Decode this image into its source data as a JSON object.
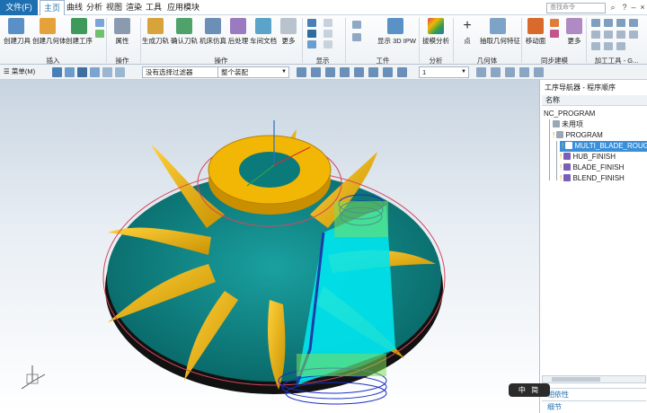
{
  "menubar": {
    "file": "文件(F)",
    "tabs": [
      "主页",
      "曲线",
      "分析",
      "视图",
      "渲染",
      "工具",
      "应用模块"
    ],
    "search_placeholder": "查找命令"
  },
  "ribbon": {
    "insert": {
      "buttons": [
        "创建刀具",
        "创建几何体",
        "创建工序"
      ],
      "label": "插入"
    },
    "operation_group": {
      "buttons": [
        "属性"
      ],
      "label": "操作"
    },
    "process": {
      "buttons": [
        "生成刀轨",
        "确认刀轨",
        "机床仿真",
        "后处理",
        "车间文档",
        "更多"
      ],
      "label": "操作"
    },
    "display": {
      "label": "显示"
    },
    "workpiece": {
      "buttons": [
        "显示 3D IPW"
      ],
      "label": "工件"
    },
    "analysis": {
      "buttons": [
        "拔模分析"
      ],
      "label": "分析"
    },
    "geometry": {
      "buttons": [
        "点",
        "抽取几何特征"
      ],
      "label": "几何体"
    },
    "sync": {
      "buttons": [
        "移动面",
        "更多"
      ],
      "label": "同步建模"
    },
    "machining_tools": {
      "label": "加工工具 - G..."
    }
  },
  "toolbar2": {
    "menu_label": "菜单(M)",
    "filter_value": "没有选择过滤器",
    "assembly_value": "整个装配",
    "count_value": "1"
  },
  "panel": {
    "title": "工序导航器 - 程序顺序",
    "column": "名称",
    "items": [
      "NC_PROGRAM",
      "未用项",
      "PROGRAM",
      "MULTI_BLADE_ROUGH",
      "HUB_FINISH",
      "BLADE_FINISH",
      "BLEND_FINISH"
    ],
    "footer": [
      "相依性",
      "细节"
    ]
  },
  "ime": {
    "text": "中 简"
  },
  "colors": {
    "accent": "#1e6fb0",
    "hub": "#f2b705",
    "surface": "#0f8a8a",
    "toolpath": "#00e5ee",
    "orbit": "#d6455a",
    "selection": "#3a8fd8"
  },
  "icons": [
    "search-icon",
    "help-icon",
    "minimize-icon",
    "close-icon",
    "view-triad-icon"
  ]
}
